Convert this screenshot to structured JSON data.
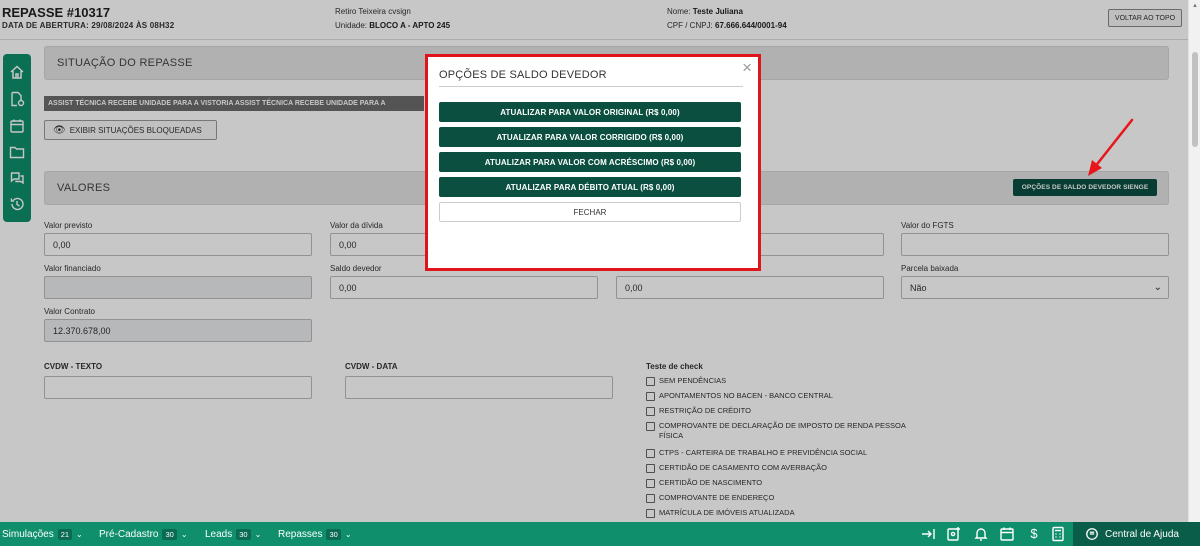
{
  "header": {
    "title": "REPASSE #10317",
    "opening": "DATA DE ABERTURA: 29/08/2024 ÀS 08H32",
    "project": "Retiro Teixeira cvsign",
    "unit_label": "Unidade:",
    "unit_value": "BLOCO A - APTO 245",
    "name_label": "Nome:",
    "name_value": "Teste Juliana",
    "doc_label": "CPF / CNPJ:",
    "doc_value": "67.666.644/0001-94",
    "top_button": "VOLTAR AO TOPO"
  },
  "sidebar": {
    "icons": [
      "home-icon",
      "document-settings-icon",
      "calendar-icon",
      "folder-icon",
      "chat-icon",
      "history-icon"
    ]
  },
  "situacao": {
    "title": "SITUAÇÃO DO REPASSE",
    "banner": "ASSIST TÉCNICA RECEBE UNIDADE PARA A VISTORIA ASSIST TÉCNICA RECEBE UNIDADE PARA A",
    "show_blocked": "EXIBIR SITUAÇÕES BLOQUEADAS"
  },
  "valores": {
    "title": "VALORES",
    "sienge_button": "OPÇÕES DE SALDO DEVEDOR SIENGE",
    "fields": {
      "valor_previsto": {
        "label": "Valor previsto",
        "value": "0,00"
      },
      "valor_divida": {
        "label": "Valor da dívida",
        "value": "0,00"
      },
      "valor_fgts": {
        "label": "Valor do FGTS",
        "value": ""
      },
      "valor_financiado": {
        "label": "Valor financiado",
        "value": ""
      },
      "saldo_devedor": {
        "label": "Saldo devedor",
        "value": "0,00"
      },
      "col3_row2": {
        "value": "0,00"
      },
      "parcela_baixada": {
        "label": "Parcela baixada",
        "value": "Não"
      },
      "valor_contrato": {
        "label": "Valor Contrato",
        "value": "12.370.678,00"
      }
    }
  },
  "custom": {
    "cvdw_texto": "CVDW - TEXTO",
    "cvdw_data": "CVDW - DATA",
    "check_title": "Teste de check",
    "checks": [
      "SEM PENDÊNCIAS",
      "APONTAMENTOS NO BACEN - BANCO CENTRAL",
      "RESTRIÇÃO DE CRÉDITO",
      "COMPROVANTE DE DECLARAÇÃO DE IMPOSTO DE RENDA PESSOA FÍSICA",
      "CTPS - CARTEIRA DE TRABALHO E PREVIDÊNCIA SOCIAL",
      "CERTIDÃO DE CASAMENTO COM AVERBAÇÃO",
      "CERTIDÃO DE NASCIMENTO",
      "COMPROVANTE DE ENDEREÇO",
      "MATRÍCULA DE IMÓVEIS ATUALIZADA"
    ]
  },
  "modal": {
    "title": "OPÇÕES DE SALDO DEVEDOR",
    "buttons": [
      "ATUALIZAR PARA VALOR ORIGINAL (R$ 0,00)",
      "ATUALIZAR PARA VALOR CORRIGIDO (R$ 0,00)",
      "ATUALIZAR PARA VALOR COM ACRÉSCIMO (R$ 0,00)",
      "ATUALIZAR PARA DÉBITO ATUAL (R$ 0,00)"
    ],
    "close": "FECHAR"
  },
  "bottombar": {
    "simulacoes": {
      "label": "Simulações",
      "count": "21"
    },
    "precadastro": {
      "label": "Pré-Cadastro",
      "count": "30"
    },
    "leads": {
      "label": "Leads",
      "count": "30"
    },
    "repasses": {
      "label": "Repasses",
      "count": "30"
    },
    "help": "Central de Ajuda",
    "dollar": "$"
  },
  "colors": {
    "primary": "#0f8f6c",
    "dark": "#0a4f40",
    "highlight": "#e0141b"
  }
}
